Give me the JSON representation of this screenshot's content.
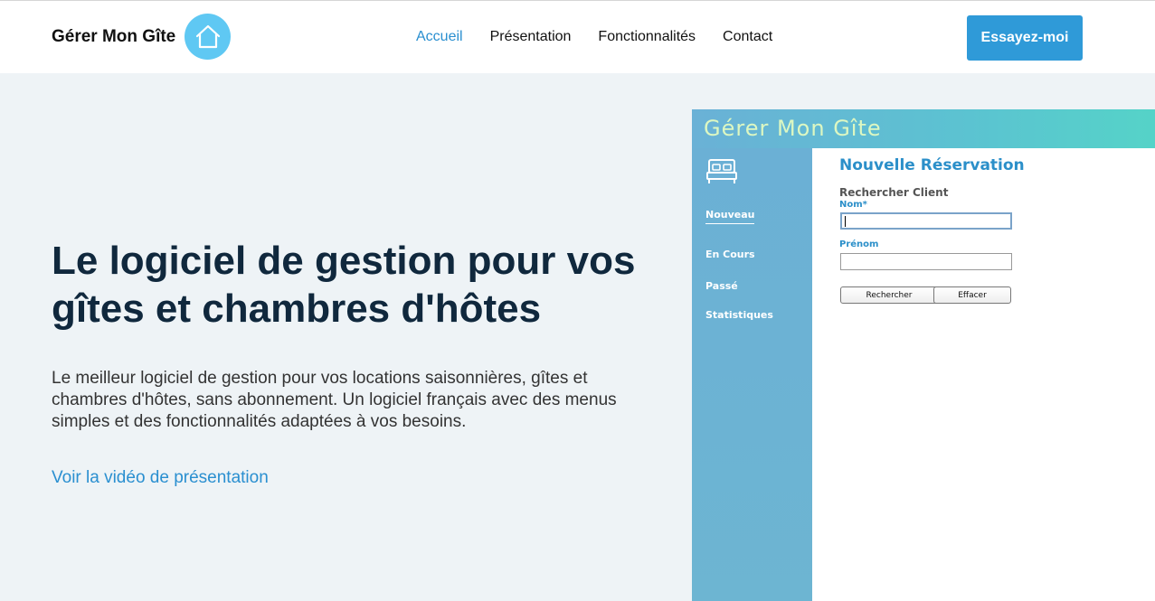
{
  "header": {
    "brand": "Gérer Mon Gîte",
    "nav": [
      {
        "label": "Accueil",
        "active": true
      },
      {
        "label": "Présentation",
        "active": false
      },
      {
        "label": "Fonctionnalités",
        "active": false
      },
      {
        "label": "Contact",
        "active": false
      }
    ],
    "cta_label": "Essayez-moi"
  },
  "hero": {
    "title": "Le logiciel de gestion pour vos gîtes et chambres d'hôtes",
    "description": "Le meilleur logiciel de gestion pour vos locations saisonnières, gîtes et chambres d'hôtes, sans abonnement. Un logiciel français avec des menus simples et des fonctionnalités adaptées à vos besoins.",
    "video_link": "Voir la vidéo de présentation"
  },
  "mockup": {
    "app_title": "Gérer Mon Gîte",
    "sidebar": [
      "Nouveau",
      "En Cours",
      "Passé",
      "Statistiques"
    ],
    "form": {
      "title": "Nouvelle Réservation",
      "subtitle": "Rechercher Client",
      "nom_label": "Nom*",
      "nom_value": "",
      "prenom_label": "Prénom",
      "prenom_value": "",
      "search_button": "Rechercher",
      "clear_button": "Effacer"
    }
  },
  "colors": {
    "accent": "#2f9ad8",
    "title": "#10283d",
    "background": "#eef3f6",
    "logo_circle": "#5fc8f3"
  },
  "icons": {
    "logo": "house-icon",
    "sidebar": "bed-icon"
  }
}
